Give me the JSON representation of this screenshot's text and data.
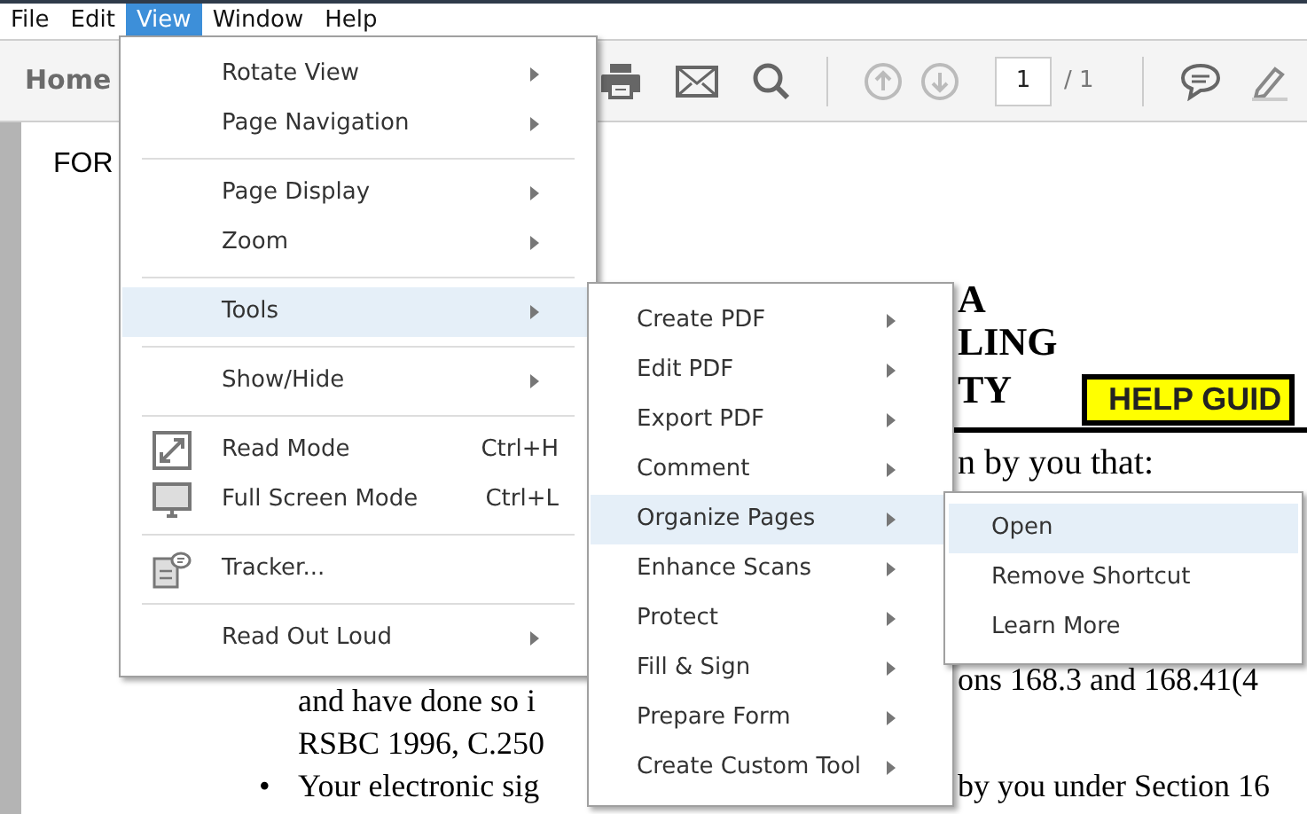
{
  "menu_bar": [
    {
      "label": "File",
      "selected": false
    },
    {
      "label": "Edit",
      "selected": false
    },
    {
      "label": "View",
      "selected": true
    },
    {
      "label": "Window",
      "selected": false
    },
    {
      "label": "Help",
      "selected": false
    }
  ],
  "toolbar": {
    "home": "Home",
    "page_number": "1",
    "page_total": "/ 1"
  },
  "document": {
    "texts": [
      {
        "kind": "plain",
        "text": "FOR"
      },
      {
        "kind": "heading",
        "text": "A"
      },
      {
        "kind": "heading",
        "text": "LING"
      },
      {
        "kind": "heading",
        "text": "TY"
      },
      {
        "kind": "badge",
        "text": "HELP GUID"
      },
      {
        "kind": "rule"
      },
      {
        "kind": "plain",
        "text": "n by you that:"
      },
      {
        "kind": "plain",
        "text": "and have done so i"
      },
      {
        "kind": "plain",
        "text": "ons 168.3 and 168.41(4"
      },
      {
        "kind": "plain",
        "text": "RSBC 1996, C.250"
      },
      {
        "kind": "bullet",
        "text": "•"
      },
      {
        "kind": "plain",
        "text": "Your electronic sig"
      },
      {
        "kind": "plain",
        "text": "by you under Section 16"
      }
    ]
  },
  "view_menu": [
    {
      "kind": "item",
      "label": "Rotate View",
      "submenu": true,
      "selected": false
    },
    {
      "kind": "item",
      "label": "Page Navigation",
      "submenu": true,
      "selected": false
    },
    {
      "kind": "separator"
    },
    {
      "kind": "item",
      "label": "Page Display",
      "submenu": true,
      "selected": false
    },
    {
      "kind": "item",
      "label": "Zoom",
      "submenu": true,
      "selected": false
    },
    {
      "kind": "separator"
    },
    {
      "kind": "item",
      "label": "Tools",
      "submenu": true,
      "selected": true
    },
    {
      "kind": "separator"
    },
    {
      "kind": "item",
      "label": "Show/Hide",
      "submenu": true,
      "selected": false
    },
    {
      "kind": "separator"
    },
    {
      "kind": "readmode",
      "label": "Read Mode",
      "shortcut": "Ctrl+H",
      "submenu": false,
      "selected": false
    },
    {
      "kind": "fullscreen",
      "label": "Full Screen Mode",
      "shortcut": "Ctrl+L",
      "submenu": false,
      "selected": false
    },
    {
      "kind": "separator"
    },
    {
      "kind": "tracker",
      "label": "Tracker...",
      "submenu": false,
      "selected": false
    },
    {
      "kind": "separator"
    },
    {
      "kind": "item",
      "label": "Read Out Loud",
      "submenu": true,
      "selected": false
    }
  ],
  "tools_menu": [
    {
      "label": "Create PDF",
      "selected": false
    },
    {
      "label": "Edit PDF",
      "selected": false
    },
    {
      "label": "Export PDF",
      "selected": false
    },
    {
      "label": "Comment",
      "selected": false
    },
    {
      "label": "Organize Pages",
      "selected": true
    },
    {
      "label": "Enhance Scans",
      "selected": false
    },
    {
      "label": "Protect",
      "selected": false
    },
    {
      "label": "Fill & Sign",
      "selected": false
    },
    {
      "label": "Prepare Form",
      "selected": false
    },
    {
      "label": "Create Custom Tool",
      "selected": false
    }
  ],
  "organize_menu": [
    {
      "label": "Open",
      "selected": true
    },
    {
      "label": "Remove Shortcut",
      "selected": false
    },
    {
      "label": "Learn More",
      "selected": false
    }
  ]
}
